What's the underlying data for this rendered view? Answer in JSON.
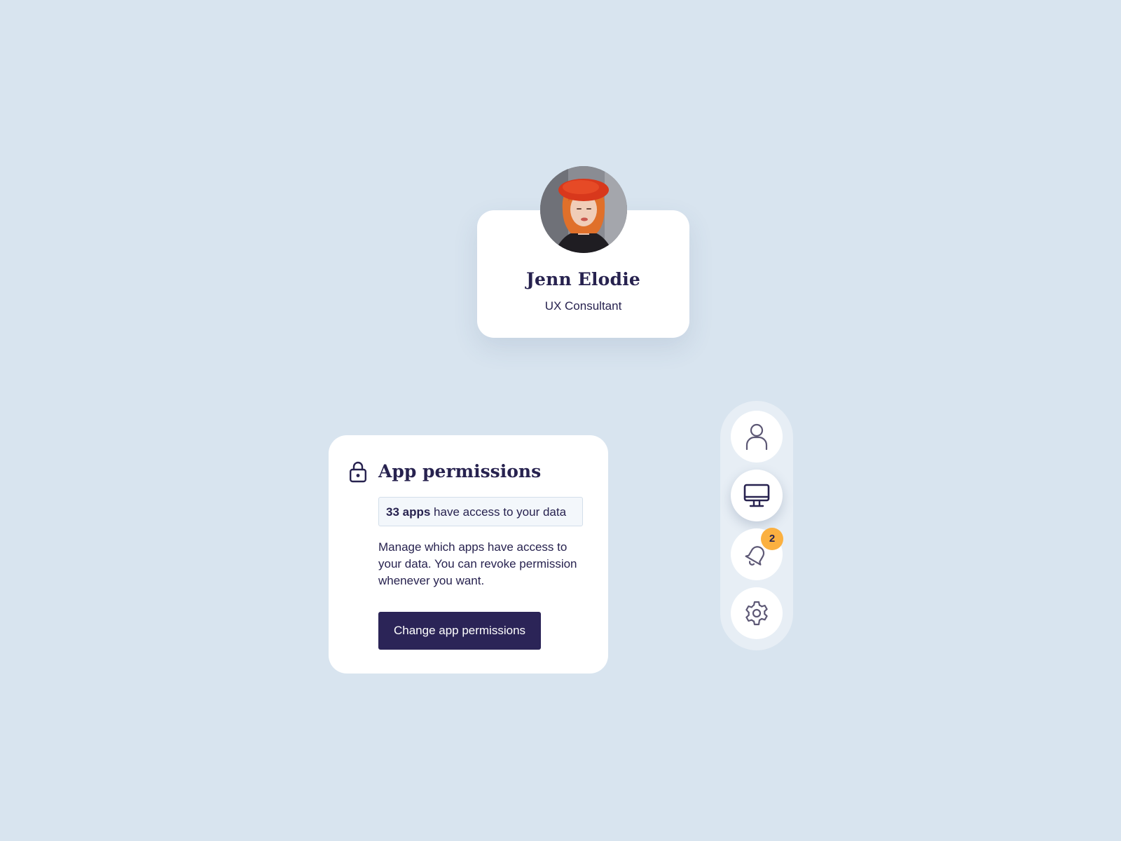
{
  "profile": {
    "name": "Jenn Elodie",
    "role": "UX Consultant"
  },
  "permissions": {
    "title": "App permissions",
    "apps_count_text": "33 apps",
    "apps_access_text": " have access to your data",
    "description": "Manage which apps have access to your data. You can revoke permission whenever you want.",
    "button_label": "Change app permissions"
  },
  "rail": {
    "items": [
      {
        "icon": "user-icon"
      },
      {
        "icon": "monitor-icon",
        "active": true
      },
      {
        "icon": "bell-icon",
        "badge": "2"
      },
      {
        "icon": "gear-icon"
      }
    ]
  },
  "colors": {
    "background": "#d8e4ef",
    "primary": "#2b2457",
    "badge": "#fbb040",
    "card": "#ffffff"
  }
}
